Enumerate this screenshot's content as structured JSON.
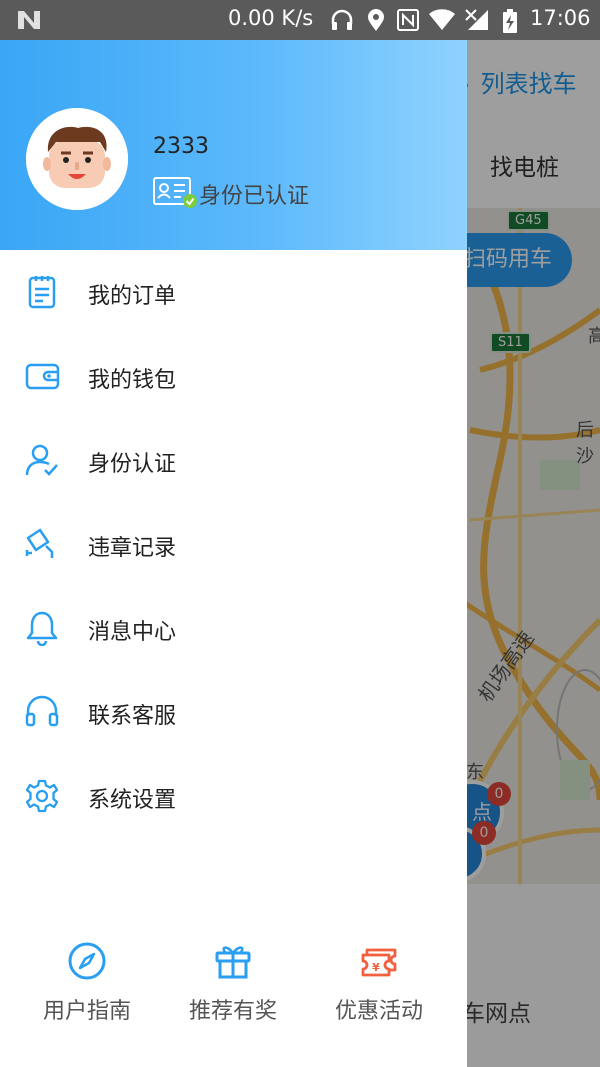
{
  "status_bar": {
    "speed": "0.00 K/s",
    "time": "17:06"
  },
  "background": {
    "list_car_label": "列表找车",
    "find_pile_label": "找电桩",
    "scan_button_label": "扫码用车",
    "road_signs": [
      "G45",
      "S11"
    ],
    "map_labels": [
      "机场高速",
      "东",
      "高",
      "后沙"
    ],
    "marker_label": "点",
    "marker_badges": [
      "0",
      "0"
    ],
    "bottom_label": "车网点"
  },
  "drawer": {
    "username": "2333",
    "verify_status": "身份已认证",
    "menu": [
      {
        "label": "我的订单",
        "icon": "order-icon"
      },
      {
        "label": "我的钱包",
        "icon": "wallet-icon"
      },
      {
        "label": "身份认证",
        "icon": "user-check-icon"
      },
      {
        "label": "违章记录",
        "icon": "camera-icon"
      },
      {
        "label": "消息中心",
        "icon": "bell-icon"
      },
      {
        "label": "联系客服",
        "icon": "headset-icon"
      },
      {
        "label": "系统设置",
        "icon": "gear-icon"
      }
    ],
    "bottom": [
      {
        "label": "用户指南",
        "icon": "compass-icon",
        "color": "#2a9ef0"
      },
      {
        "label": "推荐有奖",
        "icon": "gift-icon",
        "color": "#2a9ef0"
      },
      {
        "label": "优惠活动",
        "icon": "ticket-icon",
        "color": "#f2603f"
      }
    ]
  },
  "colors": {
    "accent": "#2a9ef0",
    "header_gradient_start": "#3aa6f5",
    "header_gradient_end": "#8fd2ff",
    "promo": "#f2603f",
    "verified_badge": "#7ccc3c"
  }
}
